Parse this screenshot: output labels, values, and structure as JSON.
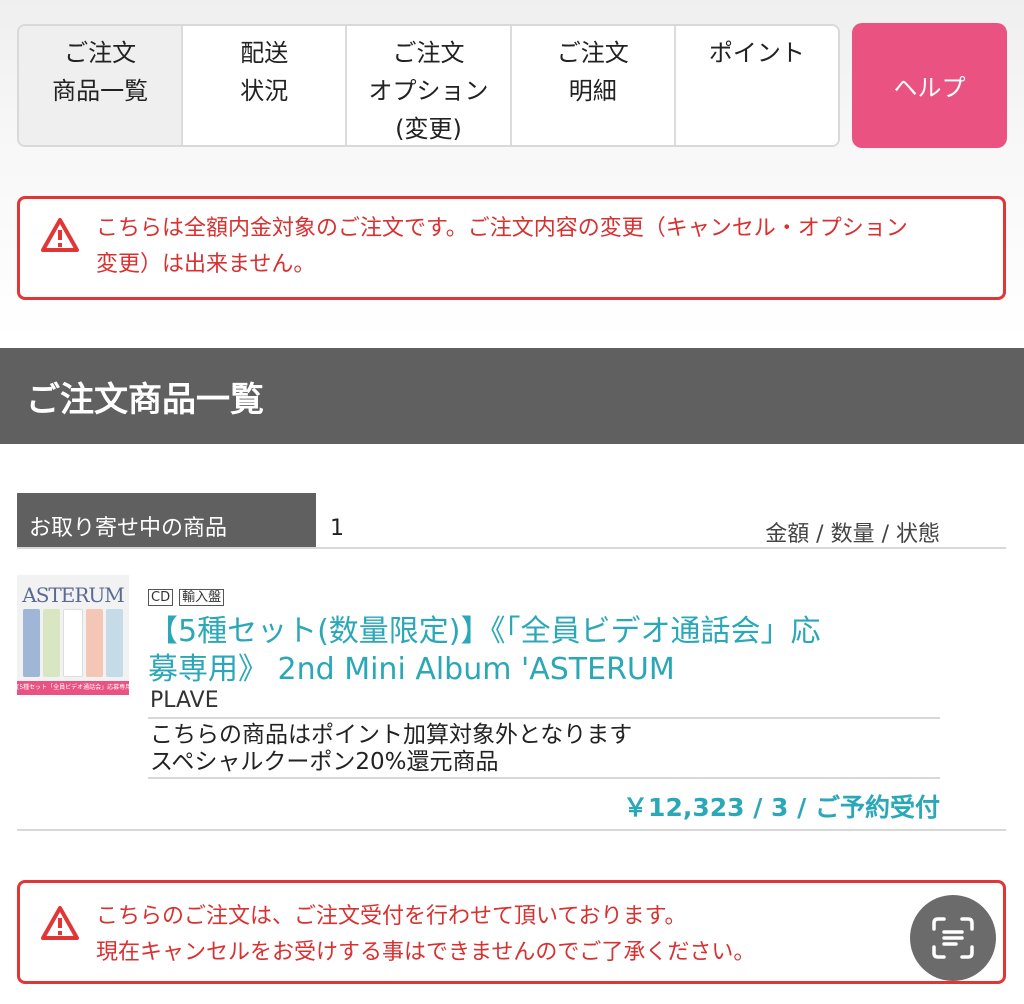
{
  "nav": {
    "tabs": [
      {
        "lines": [
          "ご注文",
          "商品一覧"
        ]
      },
      {
        "lines": [
          "配送",
          "状況"
        ]
      },
      {
        "lines": [
          "ご注文",
          "オプション",
          "(変更)"
        ]
      },
      {
        "lines": [
          "ご注文",
          "明細"
        ]
      },
      {
        "lines": [
          "ポイント"
        ]
      }
    ],
    "help_label": "ヘルプ"
  },
  "alerts": {
    "top": {
      "line1": "こちらは全額内金対象のご注文です。ご注文内容の変更（キャンセル・オプション",
      "line2": "変更）は出来ません。"
    },
    "bottom": {
      "line1": "こちらのご注文は、ご注文受付を行わせて頂いております。",
      "line2": "現在キャンセルをお受けする事はできませんのでご了承ください。"
    }
  },
  "section": {
    "title": "ご注文商品一覧"
  },
  "order_group": {
    "tab_label": "お取り寄せ中の商品",
    "count": "1",
    "column_header": "金額 / 数量 / 状態"
  },
  "product": {
    "thumbnail": {
      "title": "ASTERUM",
      "strip": "[5種セット「全員ビデオ通話会」応募専用]"
    },
    "badges": [
      "CD",
      "輸入盤"
    ],
    "title_line1": "【5種セット(数量限定)】《「全員ビデオ通話会」応",
    "title_line2": "募専用》 2nd Mini Album 'ASTERUM",
    "artist": "PLAVE",
    "note1": "こちらの商品はポイント加算対象外となります",
    "note2": "スペシャルクーポン20%還元商品",
    "price_line": "￥12,323 / 3 / ご予約受付"
  },
  "colors": {
    "accent": "#ea5381",
    "alert": "#e23636",
    "link": "#2ba8b8",
    "bar": "#606060"
  },
  "icons": {
    "alert": "warning-icon",
    "scan": "text-scan-icon"
  }
}
